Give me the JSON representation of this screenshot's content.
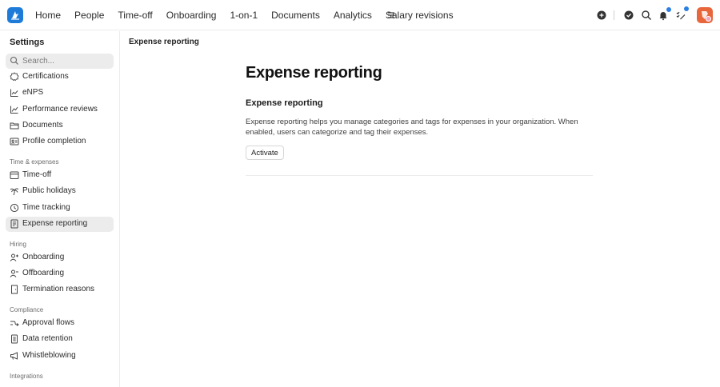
{
  "topbar": {
    "nav": [
      "Home",
      "People",
      "Time-off",
      "Onboarding",
      "1-on-1",
      "Documents",
      "Analytics",
      "Salary revisions"
    ],
    "icons": [
      "logo-icon",
      "menu-icon",
      "add-circle-icon",
      "check-circle-icon",
      "search-icon",
      "bell-icon",
      "tasks-icon",
      "avatar"
    ]
  },
  "sidebar": {
    "title": "Settings",
    "search_placeholder": "Search...",
    "groups": [
      {
        "heading": "",
        "items": [
          {
            "label": "Certifications",
            "icon": "badge-icon"
          },
          {
            "label": "eNPS",
            "icon": "chart-line-icon"
          },
          {
            "label": "Performance reviews",
            "icon": "chart-line-icon"
          },
          {
            "label": "Documents",
            "icon": "folder-icon"
          },
          {
            "label": "Profile completion",
            "icon": "profile-card-icon"
          }
        ]
      },
      {
        "heading": "Time & expenses",
        "items": [
          {
            "label": "Time-off",
            "icon": "calendar-icon"
          },
          {
            "label": "Public holidays",
            "icon": "palm-tree-icon"
          },
          {
            "label": "Time tracking",
            "icon": "clock-icon"
          },
          {
            "label": "Expense reporting",
            "icon": "receipt-icon",
            "active": true
          }
        ]
      },
      {
        "heading": "Hiring",
        "items": [
          {
            "label": "Onboarding",
            "icon": "user-plus-icon"
          },
          {
            "label": "Offboarding",
            "icon": "user-minus-icon"
          },
          {
            "label": "Termination reasons",
            "icon": "door-icon"
          }
        ]
      },
      {
        "heading": "Compliance",
        "items": [
          {
            "label": "Approval flows",
            "icon": "flow-icon"
          },
          {
            "label": "Data retention",
            "icon": "document-icon"
          },
          {
            "label": "Whistleblowing",
            "icon": "megaphone-icon"
          }
        ]
      },
      {
        "heading": "Integrations",
        "items": []
      }
    ]
  },
  "main": {
    "breadcrumb": "Expense reporting",
    "title": "Expense reporting",
    "section_title": "Expense reporting",
    "description": "Expense reporting helps you manage categories and tags for expenses in your organization. When enabled, users can categorize and tag their expenses.",
    "activate_label": "Activate"
  },
  "colors": {
    "accent": "#1e7bd8",
    "notification_dot": "#2b7fe0",
    "avatar": "#e8663b",
    "active_bg": "#ececec"
  }
}
